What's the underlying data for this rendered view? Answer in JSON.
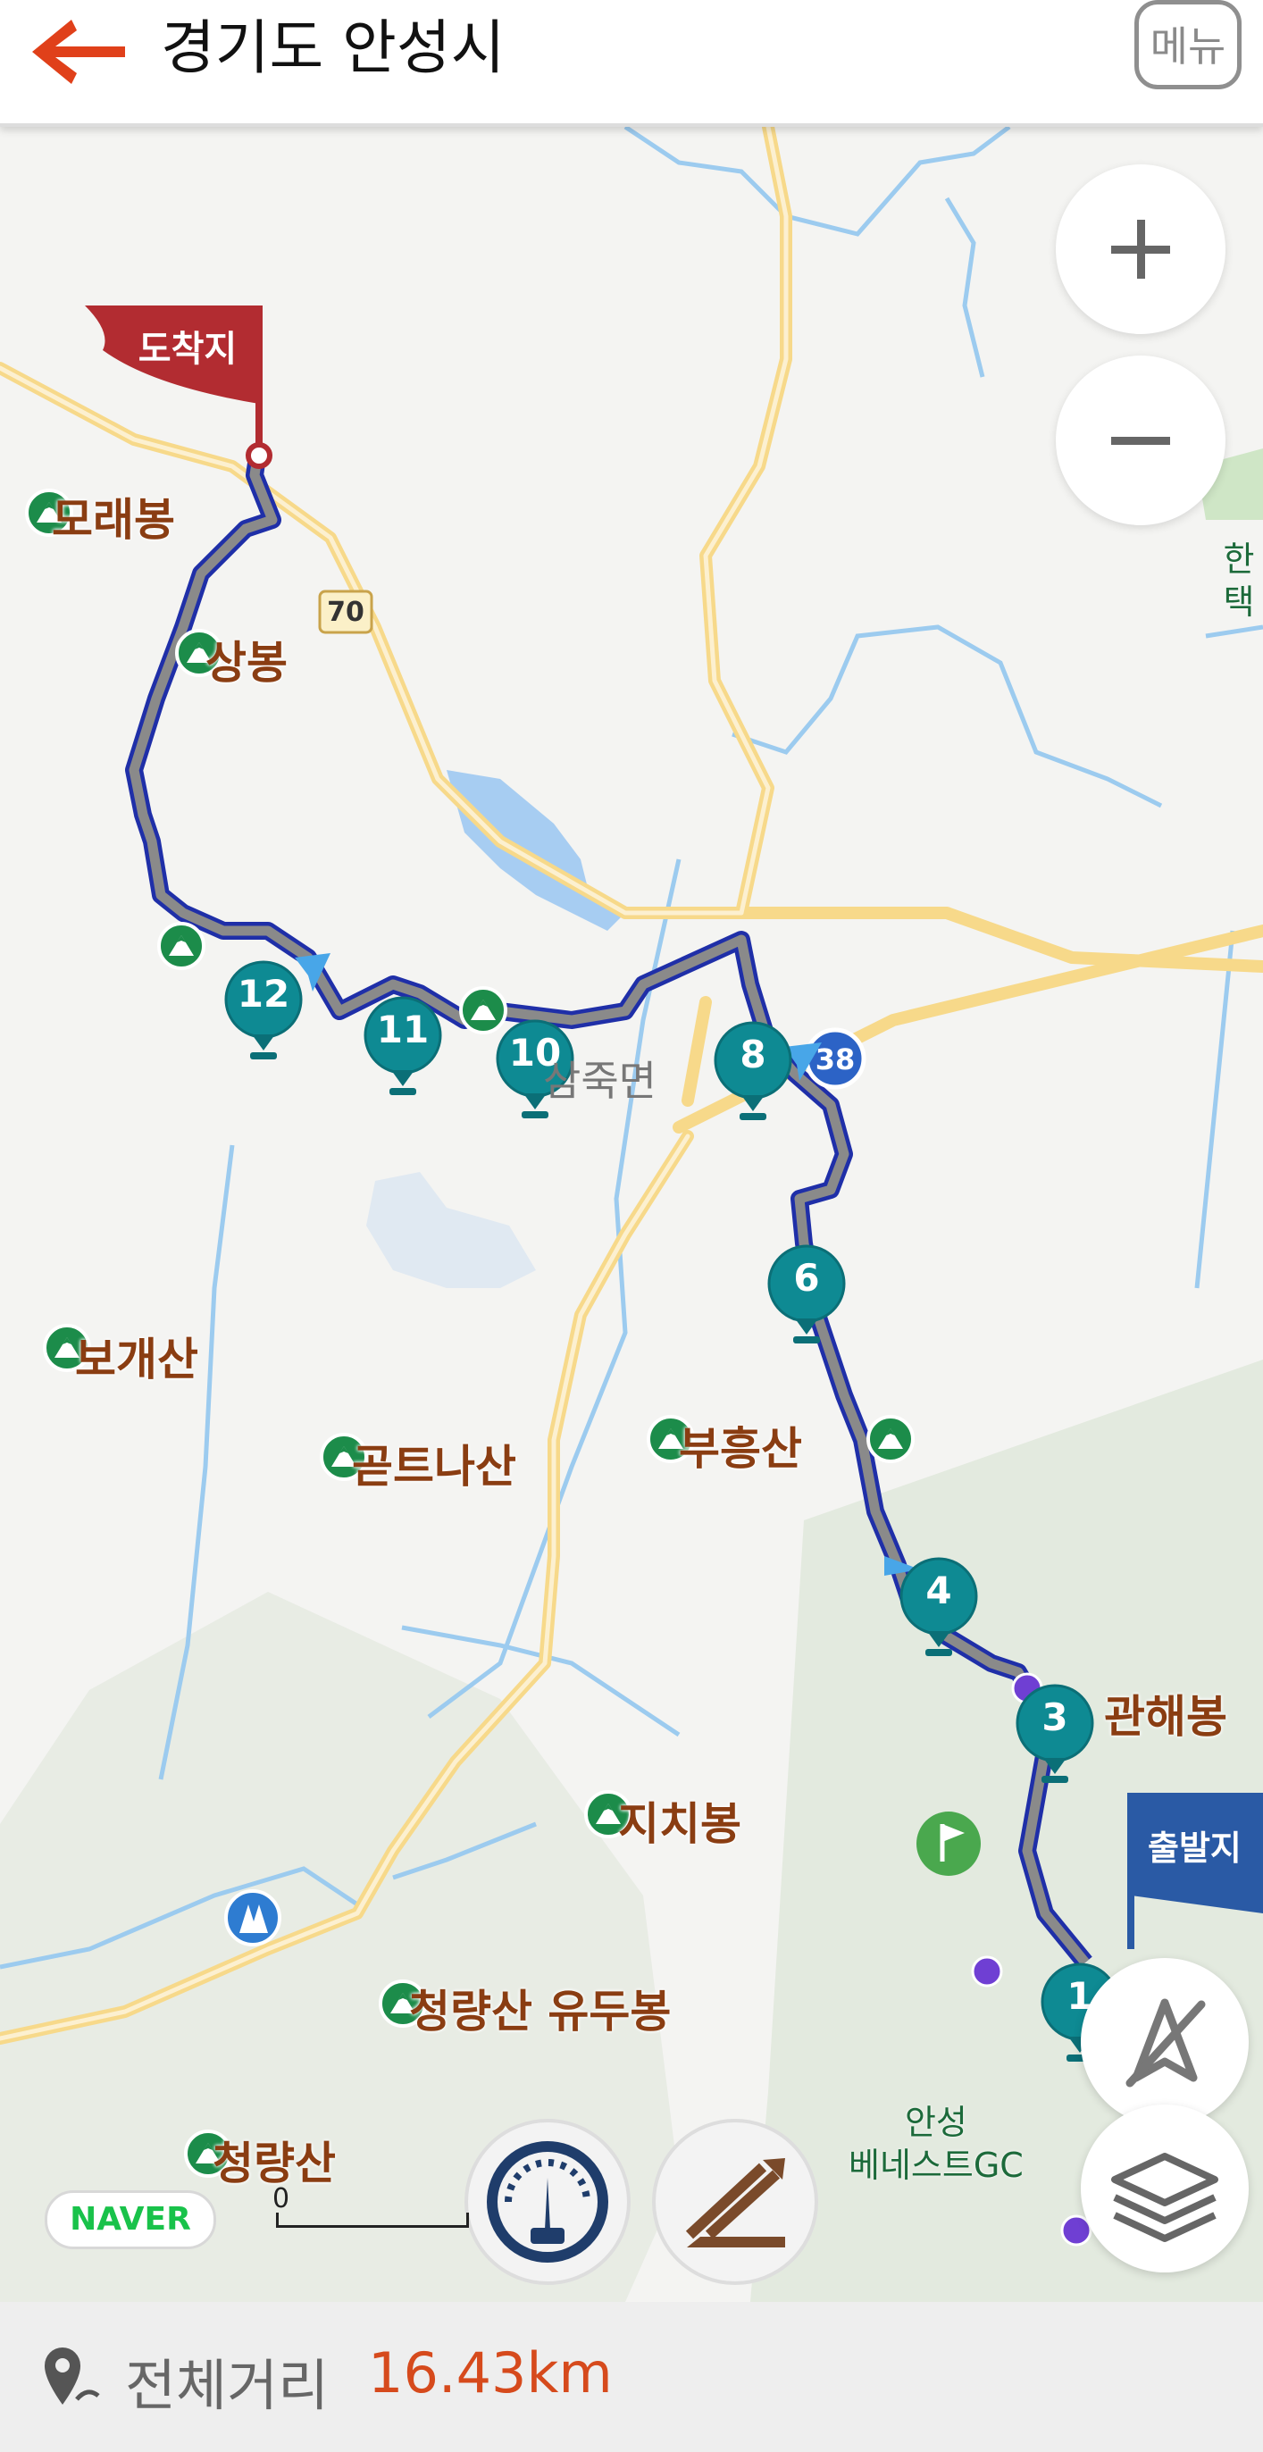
{
  "header": {
    "title": "경기도 안성시",
    "menu_label": "메뉴"
  },
  "map": {
    "flags": {
      "arrival": "도착지",
      "departure": "출발지"
    },
    "road_shields": {
      "route_70": "70",
      "route_38": "38"
    },
    "waypoints": [
      "12",
      "11",
      "10",
      "8",
      "6",
      "4",
      "3",
      "1"
    ],
    "peaks": {
      "morae": "모래봉",
      "sang": "상봉",
      "bogae": "보개산",
      "goteuna": "곧트나산",
      "buheung": "부흥산",
      "gwanhae": "관해봉",
      "jichi": "지치봉",
      "cheongryang_yudu": "청량산 유두봉",
      "cheongryang": "청량산"
    },
    "places": {
      "samjuk": "삼죽면",
      "han": "한택",
      "golf": "안성\n베네스트GC"
    },
    "brand": "NAVER",
    "scale_zero": "0"
  },
  "footer": {
    "total_distance_label": "전체거리",
    "total_distance_value": "16.43km"
  },
  "colors": {
    "route": "#1f2fa8",
    "waypoint": "#0e8a93",
    "peak_icon": "#1c8c4a",
    "flag_arrival": "#b22c31",
    "flag_departure": "#2a5aa5",
    "distance": "#d64a1c"
  }
}
